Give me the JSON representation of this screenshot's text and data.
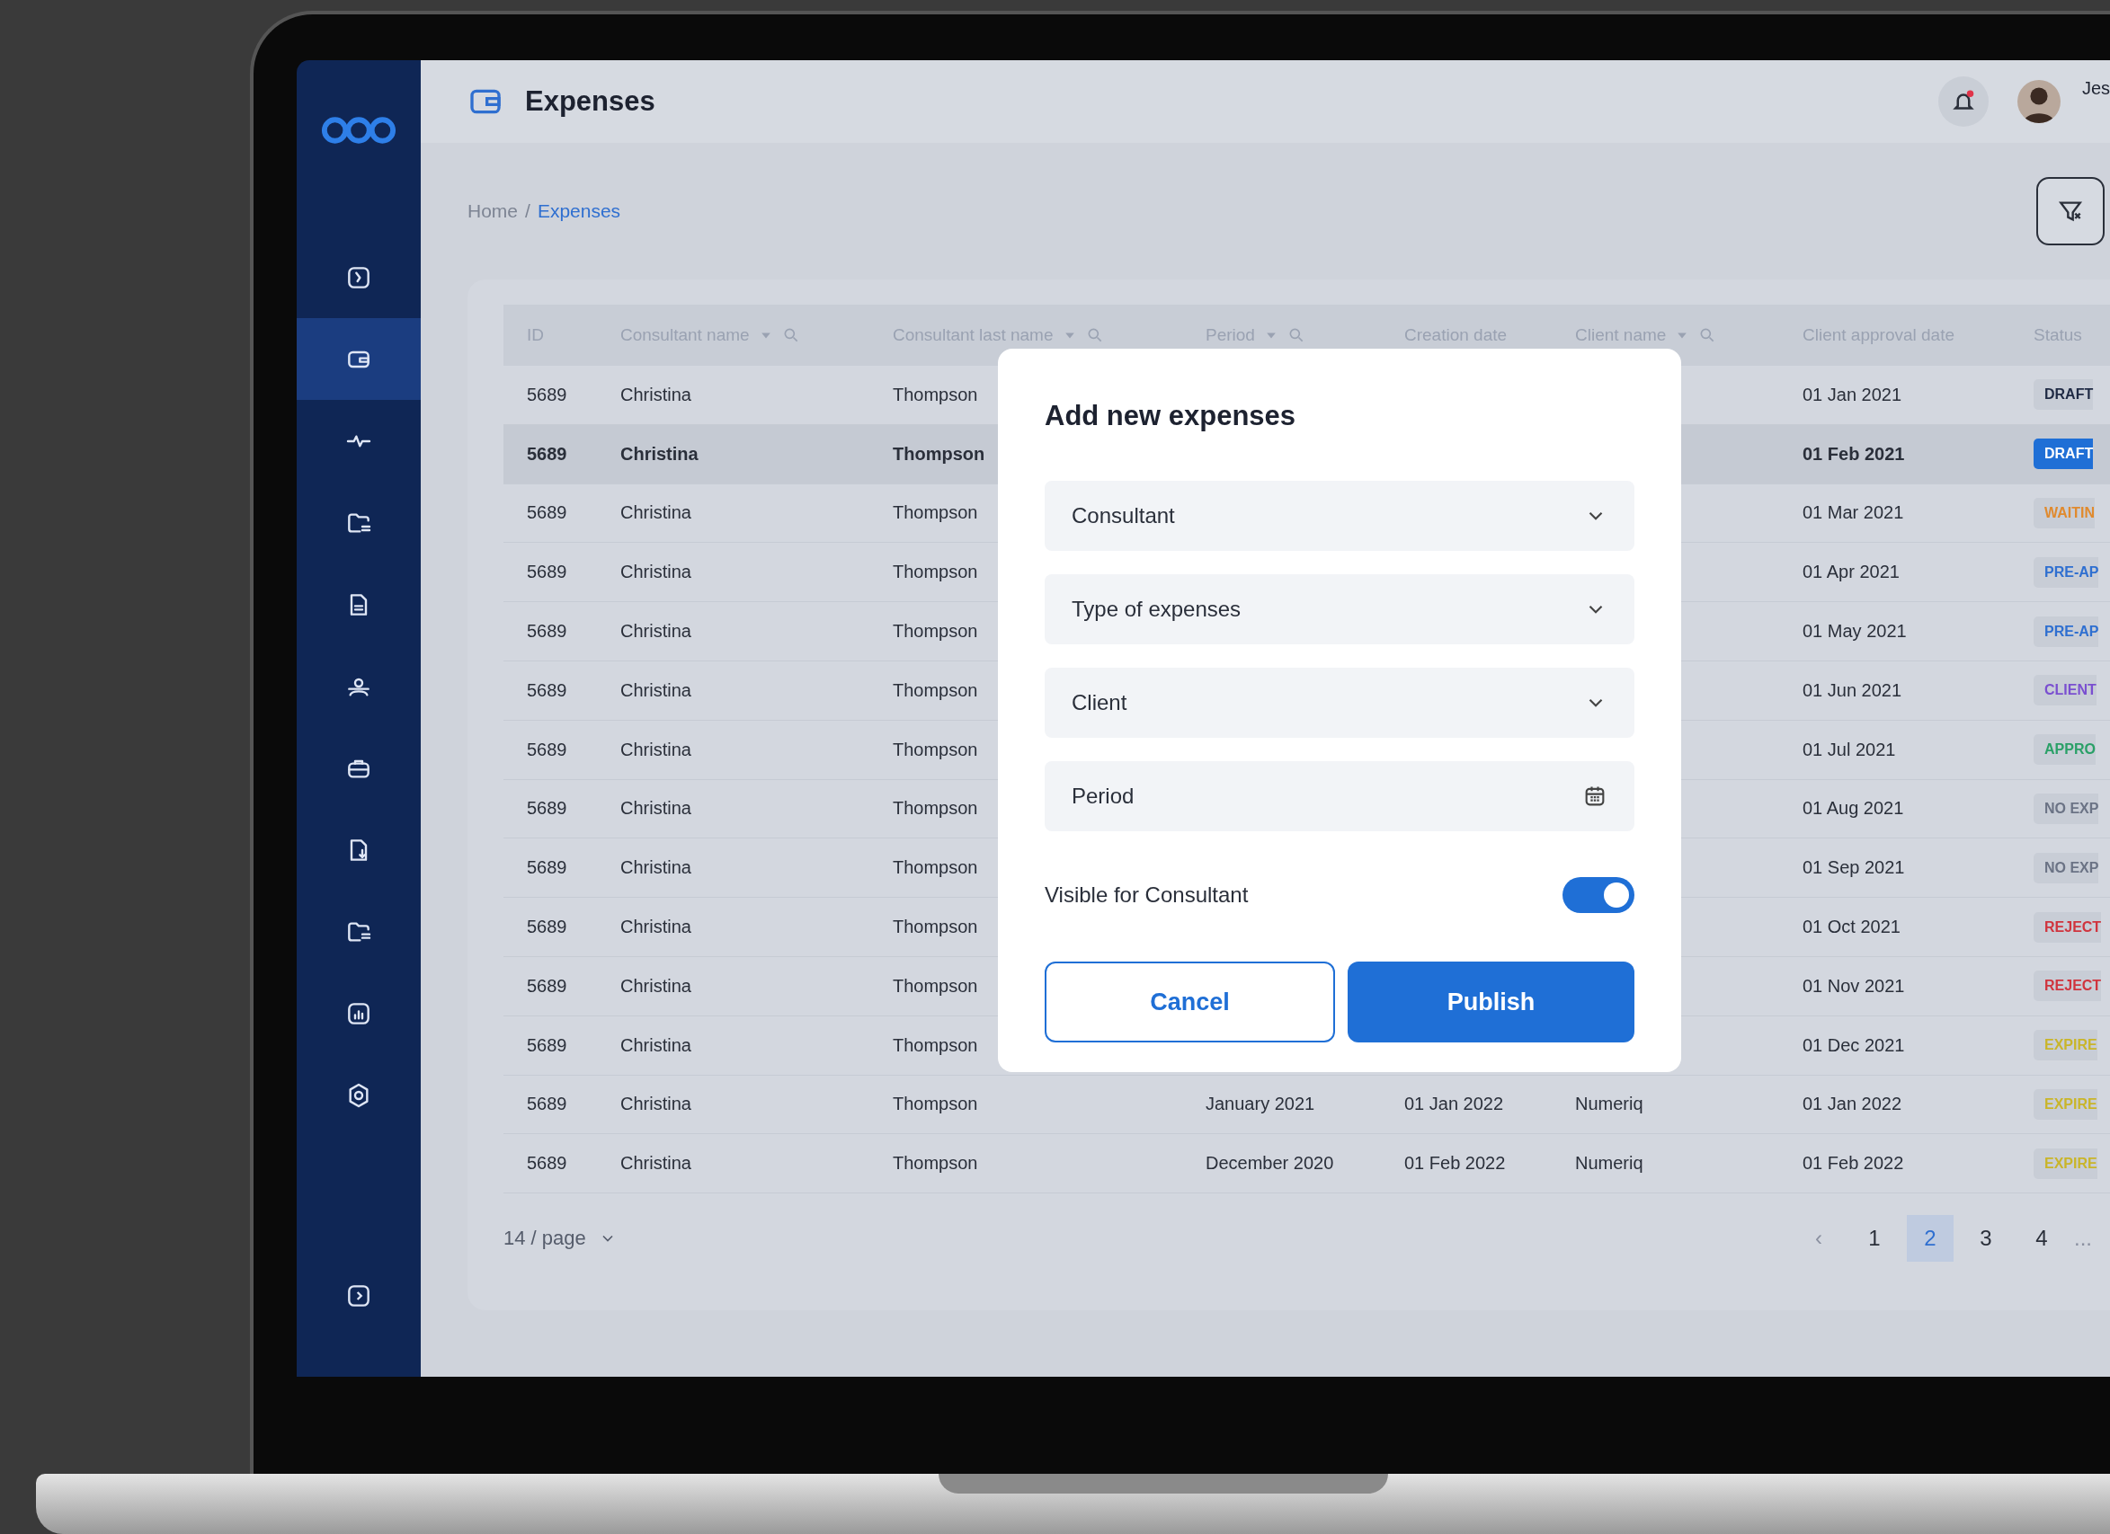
{
  "sidebar": {
    "items": [
      {
        "selected": false
      },
      {
        "selected": true
      },
      {
        "selected": false
      },
      {
        "selected": false
      },
      {
        "selected": false
      },
      {
        "selected": false
      },
      {
        "selected": false
      },
      {
        "selected": false
      },
      {
        "selected": false
      },
      {
        "selected": false
      },
      {
        "selected": false
      }
    ]
  },
  "header": {
    "title": "Expenses",
    "user_name": "Jes",
    "notification": true
  },
  "breadcrumb": [
    {
      "label": "Home",
      "current": false
    },
    {
      "label": "Expenses",
      "current": true
    }
  ],
  "breadcrumb_separator": "/",
  "table": {
    "columns": [
      {
        "label": "ID",
        "filter": false
      },
      {
        "label": "Consultant name",
        "filter": true
      },
      {
        "label": "Consultant last name",
        "filter": true
      },
      {
        "label": "Period",
        "filter": true
      },
      {
        "label": "Creation date",
        "filter": false
      },
      {
        "label": "Client name",
        "filter": true
      },
      {
        "label": "Client approval date",
        "filter": false
      },
      {
        "label": "Status",
        "filter": false
      }
    ],
    "rows": [
      {
        "id": "5689",
        "first": "Christina",
        "last": "Thompson",
        "approval": "01 Jan 2021",
        "status": "DRAFT",
        "color": "#1f2a44",
        "selected": false
      },
      {
        "id": "5689",
        "first": "Christina",
        "last": "Thompson",
        "approval": "01 Feb 2021",
        "status": "DRAFT",
        "color": "#1f6fd6",
        "selected": true
      },
      {
        "id": "5689",
        "first": "Christina",
        "last": "Thompson",
        "approval": "01 Mar 2021",
        "status": "WAITIN",
        "color": "#e08a2e",
        "selected": false
      },
      {
        "id": "5689",
        "first": "Christina",
        "last": "Thompson",
        "approval": "01 Apr 2021",
        "status": "PRE-AP",
        "color": "#2f6fd0",
        "selected": false
      },
      {
        "id": "5689",
        "first": "Christina",
        "last": "Thompson",
        "approval": "01 May 2021",
        "status": "PRE-AP",
        "color": "#2f6fd0",
        "selected": false
      },
      {
        "id": "5689",
        "first": "Christina",
        "last": "Thompson",
        "approval": "01 Jun 2021",
        "status": "CLIENT",
        "color": "#7a4fd0",
        "selected": false
      },
      {
        "id": "5689",
        "first": "Christina",
        "last": "Thompson",
        "approval": "01 Jul 2021",
        "status": "APPRO",
        "color": "#2aa067",
        "selected": false
      },
      {
        "id": "5689",
        "first": "Christina",
        "last": "Thompson",
        "approval": "01 Aug 2021",
        "status": "NO EXP",
        "color": "#6b7385",
        "selected": false
      },
      {
        "id": "5689",
        "first": "Christina",
        "last": "Thompson",
        "approval": "01 Sep 2021",
        "status": "NO EXP",
        "color": "#6b7385",
        "selected": false
      },
      {
        "id": "5689",
        "first": "Christina",
        "last": "Thompson",
        "approval": "01 Oct 2021",
        "status": "REJECT",
        "color": "#d0343e",
        "selected": false
      },
      {
        "id": "5689",
        "first": "Christina",
        "last": "Thompson",
        "approval": "01 Nov 2021",
        "status": "REJECT",
        "color": "#d0343e",
        "selected": false
      },
      {
        "id": "5689",
        "first": "Christina",
        "last": "Thompson",
        "approval": "01 Dec 2021",
        "status": "EXPIRE",
        "color": "#c9b52a",
        "selected": false
      },
      {
        "id": "5689",
        "first": "Christina",
        "last": "Thompson",
        "period": "January 2021",
        "created": "01 Jan 2022",
        "client": "Numeriq",
        "approval": "01 Jan 2022",
        "status": "EXPIRE",
        "color": "#c9b52a",
        "selected": false
      },
      {
        "id": "5689",
        "first": "Christina",
        "last": "Thompson",
        "period": "December 2020",
        "created": "01 Feb 2022",
        "client": "Numeriq",
        "approval": "01 Feb 2022",
        "status": "EXPIRE",
        "color": "#c9b52a",
        "selected": false
      }
    ]
  },
  "pagination": {
    "per_page": "14 / page",
    "prev": "‹",
    "pages": [
      {
        "label": "1",
        "selected": false
      },
      {
        "label": "2",
        "selected": true
      },
      {
        "label": "3",
        "selected": false
      },
      {
        "label": "4",
        "selected": false
      }
    ],
    "more": "..."
  },
  "dialog": {
    "title": "Add new expenses",
    "fields": [
      {
        "kind": "select",
        "placeholder": "Consultant"
      },
      {
        "kind": "select",
        "placeholder": "Type of expenses"
      },
      {
        "kind": "select",
        "placeholder": "Client"
      },
      {
        "kind": "date",
        "placeholder": "Period"
      }
    ],
    "toggle": {
      "label": "Visible for Consultant",
      "on": true
    },
    "cancel": "Cancel",
    "submit": "Publish"
  }
}
